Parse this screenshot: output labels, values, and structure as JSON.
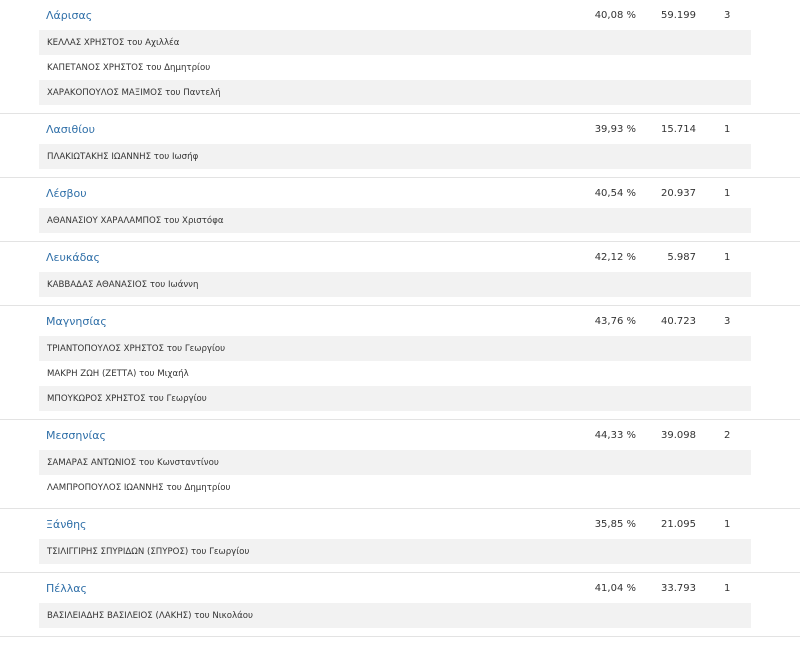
{
  "districts": [
    {
      "name": "Λάρισας",
      "percent": "40,08 %",
      "votes": "59.199",
      "seats": "3",
      "candidates": [
        "ΚΕΛΛΑΣ ΧΡΗΣΤΟΣ του Αχιλλέα",
        "ΚΑΠΕΤΑΝΟΣ ΧΡΗΣΤΟΣ του Δημητρίου",
        "ΧΑΡΑΚΟΠΟΥΛΟΣ ΜΑΞΙΜΟΣ του Παντελή"
      ]
    },
    {
      "name": "Λασιθίου",
      "percent": "39,93 %",
      "votes": "15.714",
      "seats": "1",
      "candidates": [
        "ΠΛΑΚΙΩΤΑΚΗΣ ΙΩΑΝΝΗΣ του Ιωσήφ"
      ]
    },
    {
      "name": "Λέσβου",
      "percent": "40,54 %",
      "votes": "20.937",
      "seats": "1",
      "candidates": [
        "ΑΘΑΝΑΣΙΟΥ ΧΑΡΑΛΑΜΠΟΣ του Χριστόφα"
      ]
    },
    {
      "name": "Λευκάδας",
      "percent": "42,12 %",
      "votes": "5.987",
      "seats": "1",
      "candidates": [
        "ΚΑΒΒΑΔΑΣ ΑΘΑΝΑΣΙΟΣ του Ιωάννη"
      ]
    },
    {
      "name": "Μαγνησίας",
      "percent": "43,76 %",
      "votes": "40.723",
      "seats": "3",
      "candidates": [
        "ΤΡΙΑΝΤΟΠΟΥΛΟΣ ΧΡΗΣΤΟΣ του Γεωργίου",
        "ΜΑΚΡΗ ΖΩΗ (ΖΕΤΤΑ) του Μιχαήλ",
        "ΜΠΟΥΚΩΡΟΣ ΧΡΗΣΤΟΣ του Γεωργίου"
      ]
    },
    {
      "name": "Μεσσηνίας",
      "percent": "44,33 %",
      "votes": "39.098",
      "seats": "2",
      "candidates": [
        "ΣΑΜΑΡΑΣ ΑΝΤΩΝΙΟΣ του Κωνσταντίνου",
        "ΛΑΜΠΡΟΠΟΥΛΟΣ ΙΩΑΝΝΗΣ του Δημητρίου"
      ]
    },
    {
      "name": "Ξάνθης",
      "percent": "35,85 %",
      "votes": "21.095",
      "seats": "1",
      "candidates": [
        "ΤΣΙΛΙΓΓΙΡΗΣ ΣΠΥΡΙΔΩΝ (ΣΠΥΡΟΣ) του Γεωργίου"
      ]
    },
    {
      "name": "Πέλλας",
      "percent": "41,04 %",
      "votes": "33.793",
      "seats": "1",
      "candidates": [
        "ΒΑΣΙΛΕΙΑΔΗΣ ΒΑΣΙΛΕΙΟΣ (ΛΑΚΗΣ) του Νικολάου"
      ]
    }
  ]
}
